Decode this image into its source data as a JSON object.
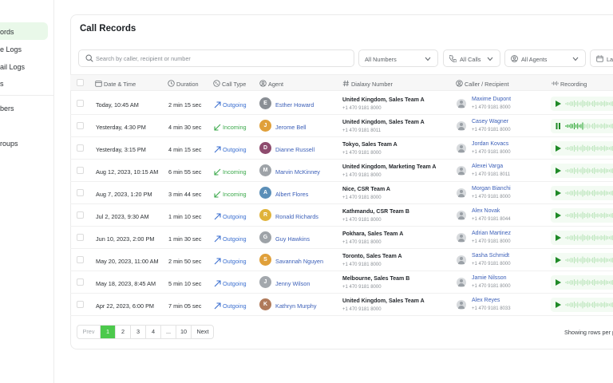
{
  "sidebar": {
    "items": [
      {
        "label": "ords",
        "active": true
      },
      {
        "label": "e Logs"
      },
      {
        "label": "ail Logs"
      },
      {
        "label": "s"
      },
      {
        "label": "bers"
      },
      {
        "label": "roups"
      }
    ]
  },
  "page": {
    "title": "Call Records"
  },
  "filters": {
    "search_placeholder": "Search by caller, recipient or number",
    "numbers": "All Numbers",
    "calls": "All Calls",
    "agents": "All Agents",
    "date": "La"
  },
  "table": {
    "headers": {
      "datetime": "Date & Time",
      "duration": "Duration",
      "calltype": "Call Type",
      "agent": "Agent",
      "dialaxy": "Dialaxy Number",
      "caller": "Caller / Recipient",
      "recording": "Recording"
    },
    "rows": [
      {
        "datetime": "Today, 10:45 AM",
        "duration": "2 min 15 sec",
        "type": "Outgoing",
        "agent": "Esther Howard",
        "agent_initial": "E",
        "agent_color": "#8a8f95",
        "team": "United Kingdom, Sales Team A",
        "dialaxy_phone": "+1 470 9181 8000",
        "caller": "Maxime Dupont",
        "caller_phone": "+1 470 9181 8000",
        "playing": false
      },
      {
        "datetime": "Yesterday, 4:30 PM",
        "duration": "4 min 30 sec",
        "type": "Incoming",
        "agent": "Jerome Bell",
        "agent_initial": "J",
        "agent_color": "#e0a03a",
        "team": "United Kingdom, Sales Team A",
        "dialaxy_phone": "+1 470 9181 8011",
        "caller": "Casey Wagner",
        "caller_phone": "+1 470 9181 8000",
        "playing": true
      },
      {
        "datetime": "Yesterday, 3:15 PM",
        "duration": "4 min 15 sec",
        "type": "Outgoing",
        "agent": "Dianne Russell",
        "agent_initial": "D",
        "agent_color": "#8e4b6e",
        "team": "Tokyo, Sales Team A",
        "dialaxy_phone": "+1 470 9181 8000",
        "caller": "Jordan Kovacs",
        "caller_phone": "+1 470 9181 8000",
        "playing": false
      },
      {
        "datetime": "Aug 12, 2023, 10:15 AM",
        "duration": "6 min 55 sec",
        "type": "Incoming",
        "agent": "Marvin McKinney",
        "agent_initial": "M",
        "agent_color": "#9ea3a8",
        "team": "United Kingdom, Marketing Team A",
        "dialaxy_phone": "+1 470 9181 8000",
        "caller": "Alexei Varga",
        "caller_phone": "+1 470 9181 8011",
        "playing": false
      },
      {
        "datetime": "Aug 7, 2023, 1:20 PM",
        "duration": "3 min 44 sec",
        "type": "Incoming",
        "agent": "Albert Flores",
        "agent_initial": "A",
        "agent_color": "#5b8fb8",
        "team": "Nice, CSR Team A",
        "dialaxy_phone": "+1 470 9181 8000",
        "caller": "Morgan Bianchi",
        "caller_phone": "+1 470 9181 8000",
        "playing": false
      },
      {
        "datetime": "Jul 2, 2023, 9:30 AM",
        "duration": "1 min 10 sec",
        "type": "Outgoing",
        "agent": "Ronald Richards",
        "agent_initial": "R",
        "agent_color": "#e0b33a",
        "team": "Kathmandu, CSR Team B",
        "dialaxy_phone": "+1 470 9181 8000",
        "caller": "Alex Novak",
        "caller_phone": "+1 470 9181 8044",
        "playing": false
      },
      {
        "datetime": "Jun 10, 2023, 2:00 PM",
        "duration": "1 min 30 sec",
        "type": "Outgoing",
        "agent": "Guy Hawkins",
        "agent_initial": "G",
        "agent_color": "#9ea3a8",
        "team": "Pokhara, Sales Team A",
        "dialaxy_phone": "+1 470 9181 8000",
        "caller": "Adrian Martinez",
        "caller_phone": "+1 470 9181 8000",
        "playing": false
      },
      {
        "datetime": "May 20, 2023, 11:00 AM",
        "duration": "2 min 50 sec",
        "type": "Outgoing",
        "agent": "Savannah Nguyen",
        "agent_initial": "S",
        "agent_color": "#e0a03a",
        "team": "Toronto, Sales Team A",
        "dialaxy_phone": "+1 470 9181 8000",
        "caller": "Sasha Schmidt",
        "caller_phone": "+1 470 9181 8000",
        "playing": false
      },
      {
        "datetime": "May 18, 2023, 8:45 AM",
        "duration": "5 min 10 sec",
        "type": "Outgoing",
        "agent": "Jenny Wilson",
        "agent_initial": "J",
        "agent_color": "#a3a8ad",
        "team": "Melbourne, Sales Team B",
        "dialaxy_phone": "+1 470 9181 8000",
        "caller": "Jamie Nilsson",
        "caller_phone": "+1 470 9181 8000",
        "playing": false
      },
      {
        "datetime": "Apr 22, 2023, 6:00 PM",
        "duration": "7 min 05 sec",
        "type": "Outgoing",
        "agent": "Kathryn Murphy",
        "agent_initial": "K",
        "agent_color": "#b07a5a",
        "team": "United Kingdom, Sales Team A",
        "dialaxy_phone": "+1 470 9181 8000",
        "caller": "Alex Reyes",
        "caller_phone": "+1 470 9181 8033",
        "playing": false
      }
    ]
  },
  "pagination": {
    "prev": "Prev",
    "pages": [
      "1",
      "2",
      "3",
      "4",
      "...",
      "10"
    ],
    "next": "Next",
    "current": "1",
    "showing": "Showing rows per p"
  },
  "colors": {
    "accent": "#4cc94c",
    "link": "#3b5fb8",
    "incoming": "#3aa84a",
    "outgoing": "#3b6fd0"
  }
}
